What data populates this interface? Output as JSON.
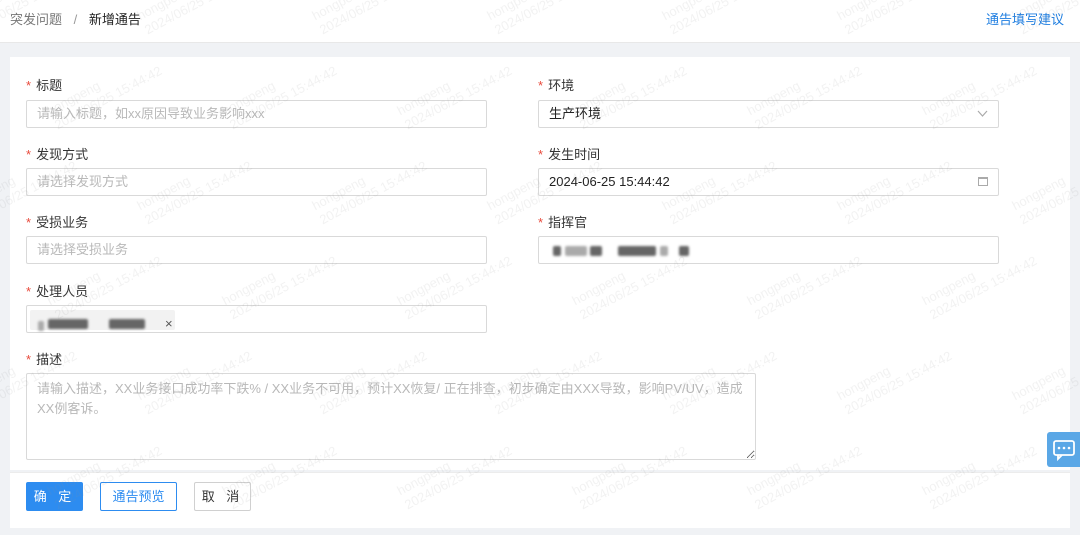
{
  "breadcrumb": {
    "parent": "突发问题",
    "separator": "/",
    "current": "新增通告"
  },
  "header": {
    "help_link": "通告填写建议"
  },
  "form": {
    "title": {
      "label": "标题",
      "placeholder": "请输入标题，如xx原因导致业务影响xxx"
    },
    "environment": {
      "label": "环境",
      "value": "生产环境"
    },
    "discovery_method": {
      "label": "发现方式",
      "placeholder": "请选择发现方式"
    },
    "occurred_time": {
      "label": "发生时间",
      "value": "2024-06-25 15:44:42"
    },
    "affected_business": {
      "label": "受损业务",
      "placeholder": "请选择受损业务"
    },
    "commander": {
      "label": "指挥官"
    },
    "handlers": {
      "label": "处理人员",
      "remove_symbol": "×"
    },
    "description": {
      "label": "描述",
      "placeholder": "请输入描述，XX业务接口成功率下跌% / XX业务不可用，预计XX恢复/ 正在排查，初步确定由XXX导致，影响PV/UV，造成XX例客诉。"
    }
  },
  "actions": {
    "confirm": "确 定",
    "preview": "通告预览",
    "cancel": "取 消"
  },
  "icons": {
    "select_arrow": "chevron-down-icon",
    "date": "calendar-icon",
    "chat": "chat-icon"
  },
  "watermark": {
    "user": "hongpeng",
    "time": "2024/06/25 15:44:42"
  },
  "colors": {
    "primary": "#2d8cf0",
    "link": "#1f7ee0",
    "required": "#e84a3c",
    "page_bg": "#f0f2f5"
  }
}
